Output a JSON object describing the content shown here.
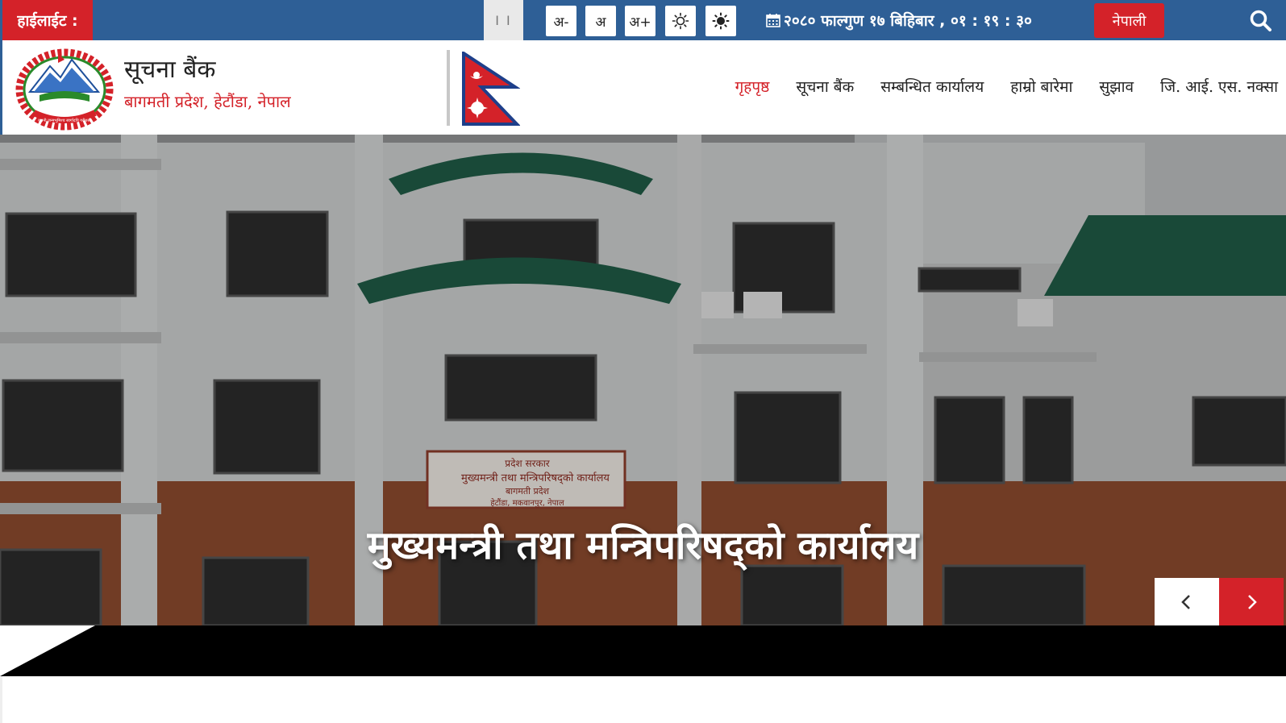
{
  "topbar": {
    "highlight_label": "हाईलाईट :",
    "pause_label": "I I",
    "font_decrease": "अ-",
    "font_normal": "अ",
    "font_increase": "अ+",
    "datetime": "२०८० फाल्गुण १७ बिहिबार , ०१ : १९ : ३०",
    "language_button": "नेपाली",
    "icons": {
      "calendar": "calendar-icon",
      "light_mode": "sun-outline-icon",
      "dark_mode": "sun-filled-icon",
      "search": "search-icon"
    }
  },
  "header": {
    "title": "सूचना बैंक",
    "subtitle": "बागमती प्रदेश, हेटौंडा, नेपाल",
    "emblem_text": "जननी जन्मभूमिश्च स्वर्गादपि गरीयसी"
  },
  "nav": {
    "items": [
      {
        "label": "गृहपृष्ठ",
        "active": true
      },
      {
        "label": "सूचना बैंक",
        "active": false
      },
      {
        "label": "सम्बन्धित कार्यालय",
        "active": false
      },
      {
        "label": "हाम्रो बारेमा",
        "active": false
      },
      {
        "label": "सुझाव",
        "active": false
      },
      {
        "label": "जि. आई. एस. नक्सा",
        "active": false
      }
    ]
  },
  "hero": {
    "caption": "मुख्यमन्त्री तथा मन्त्रिपरिषद्को कार्यालय",
    "signboard": {
      "line1": "प्रदेश सरकार",
      "line2": "मुख्यमन्त्री तथा मन्त्रिपरिषद्को कार्यालय",
      "line3": "बागमती प्रदेश",
      "line4": "हेटौंडा, मकवानपुर, नेपाल"
    },
    "prev_icon": "chevron-left-icon",
    "next_icon": "chevron-right-icon"
  },
  "colors": {
    "topbar_blue": "#2e5f96",
    "accent_red": "#d42229"
  }
}
